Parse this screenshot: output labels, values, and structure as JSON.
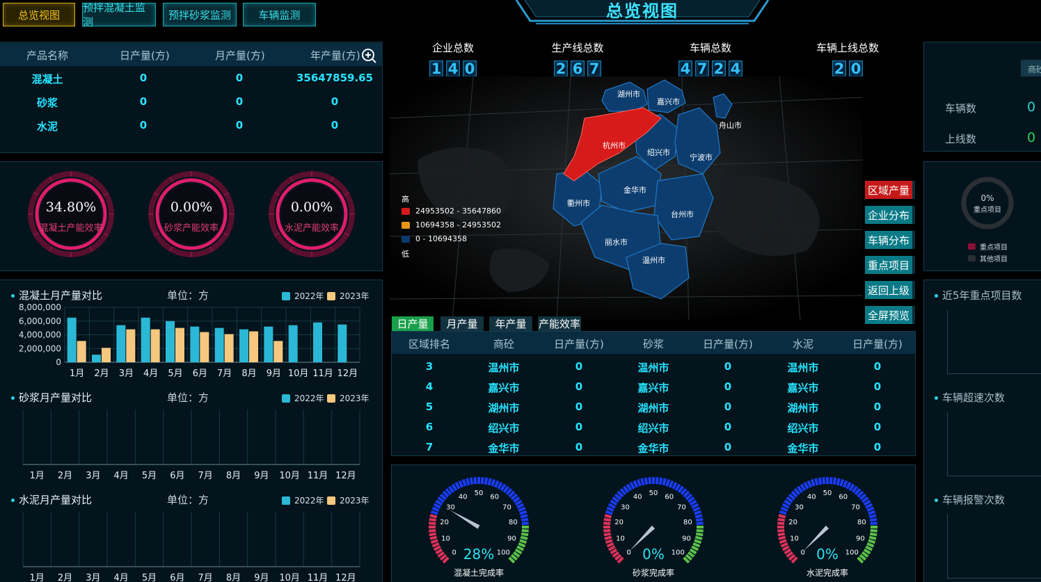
{
  "nav": {
    "overview": "总览视图",
    "concrete": "预拌混凝土监测",
    "mortar": "预拌砂浆监测",
    "vehicle": "车辆监测"
  },
  "page_title": "总览视图",
  "product_table": {
    "headers": [
      "产品名称",
      "日产量(方)",
      "月产量(方)",
      "年产量(方)"
    ],
    "rows": [
      [
        "混凝土",
        "0",
        "0",
        "35647859.65"
      ],
      [
        "砂浆",
        "0",
        "0",
        "0"
      ],
      [
        "水泥",
        "0",
        "0",
        "0"
      ]
    ]
  },
  "efficiency_rings": [
    {
      "value": "34.80%",
      "label": "混凝土产能效率",
      "fraction": 0.348
    },
    {
      "value": "0.00%",
      "label": "砂浆产能效率",
      "fraction": 0
    },
    {
      "value": "0.00%",
      "label": "水泥产能效率",
      "fraction": 0
    }
  ],
  "monthly_sections": [
    {
      "title": "混凝土月产量对比",
      "unit": "单位：方"
    },
    {
      "title": "砂浆月产量对比",
      "unit": "单位：方"
    },
    {
      "title": "水泥月产量对比",
      "unit": "单位：方"
    }
  ],
  "legend": {
    "y2022": "2022年",
    "y2023": "2023年",
    "c2022": "#2ab8d6",
    "c2023": "#f6c77e"
  },
  "chart_data": [
    {
      "type": "bar",
      "categories": [
        "1月",
        "2月",
        "3月",
        "4月",
        "5月",
        "6月",
        "7月",
        "8月",
        "9月",
        "10月",
        "11月",
        "12月"
      ],
      "series": [
        {
          "name": "2022年",
          "values": [
            6500000,
            1100000,
            5400000,
            6500000,
            6000000,
            5200000,
            5000000,
            4800000,
            5200000,
            5400000,
            5800000,
            5500000
          ]
        },
        {
          "name": "2023年",
          "values": [
            3100000,
            2100000,
            4800000,
            4800000,
            5000000,
            4400000,
            4100000,
            4500000,
            3100000,
            null,
            null,
            null
          ]
        }
      ],
      "yticks": [
        "8,000,000",
        "6,000,000",
        "4,000,000",
        "2,000,000",
        "0"
      ],
      "ylim": [
        0,
        8000000
      ]
    },
    {
      "type": "bar",
      "categories": [
        "1月",
        "2月",
        "3月",
        "4月",
        "5月",
        "6月",
        "7月",
        "8月",
        "9月",
        "10月",
        "11月",
        "12月"
      ],
      "series": [
        {
          "name": "2022年",
          "values": []
        },
        {
          "name": "2023年",
          "values": []
        }
      ]
    },
    {
      "type": "bar",
      "categories": [
        "1月",
        "2月",
        "3月",
        "4月",
        "5月",
        "6月",
        "7月",
        "8月",
        "9月",
        "10月",
        "11月",
        "12月"
      ],
      "series": [
        {
          "name": "2022年",
          "values": []
        },
        {
          "name": "2023年",
          "values": []
        }
      ]
    }
  ],
  "stats": [
    {
      "label": "企业总数",
      "digits": [
        "1",
        "4",
        "0"
      ]
    },
    {
      "label": "生产线总数",
      "digits": [
        "2",
        "6",
        "7"
      ]
    },
    {
      "label": "车辆总数",
      "digits": [
        "4",
        "7",
        "2",
        "4"
      ]
    },
    {
      "label": "车辆上线总数",
      "digits": [
        "2",
        "0"
      ]
    }
  ],
  "map": {
    "cities": [
      "湖州市",
      "嘉兴市",
      "舟山市",
      "杭州市",
      "绍兴市",
      "宁波市",
      "衢州市",
      "金华市",
      "台州市",
      "丽水市",
      "温州市"
    ],
    "legend_high": "高",
    "legend_low": "低",
    "ranges": [
      "24953502 - 35647860",
      "10694358 - 24953502",
      "0 - 10694358"
    ],
    "range_colors": [
      "#d71a1a",
      "#e99512",
      "#0c3b6e"
    ],
    "highlight_color": "#d71a1a",
    "region_color": "#0d3d6e"
  },
  "side_buttons": [
    "区域产量",
    "企业分布",
    "车辆分布",
    "重点项目",
    "返回上级",
    "全屏预览"
  ],
  "ranking_tabs": [
    "日产量",
    "月产量",
    "年产量",
    "产能效率"
  ],
  "ranking_table": {
    "headers": [
      "区域排名",
      "商砼",
      "日产量(方)",
      "砂浆",
      "日产量(方)",
      "水泥",
      "日产量(方)"
    ],
    "rows": [
      [
        "3",
        "温州市",
        "0",
        "温州市",
        "0",
        "温州市",
        "0"
      ],
      [
        "4",
        "嘉兴市",
        "0",
        "嘉兴市",
        "0",
        "嘉兴市",
        "0"
      ],
      [
        "5",
        "湖州市",
        "0",
        "湖州市",
        "0",
        "湖州市",
        "0"
      ],
      [
        "6",
        "绍兴市",
        "0",
        "绍兴市",
        "0",
        "绍兴市",
        "0"
      ],
      [
        "7",
        "金华市",
        "0",
        "金华市",
        "0",
        "金华市",
        "0"
      ]
    ]
  },
  "completion_gauges": [
    {
      "value": "28%",
      "pct": 28,
      "label": "混凝土完成率"
    },
    {
      "value": "0%",
      "pct": 0,
      "label": "砂浆完成率"
    },
    {
      "value": "0%",
      "pct": 0,
      "label": "水泥完成率"
    }
  ],
  "gauge_ticks": [
    "0",
    "10",
    "20",
    "30",
    "40",
    "50",
    "60",
    "70",
    "80",
    "90",
    "100"
  ],
  "right_panel": {
    "tab_label": "商砼",
    "vehicle_count_label": "车辆数",
    "vehicle_count": "0",
    "online_label": "上线数",
    "online_count": "0",
    "donut_value": "0%",
    "donut_label": "重点项目",
    "donut_legend": [
      "重点项目",
      "其他项目"
    ],
    "sections": [
      "近5年重点项目数",
      "车辆超速次数",
      "车辆报警次数"
    ]
  }
}
